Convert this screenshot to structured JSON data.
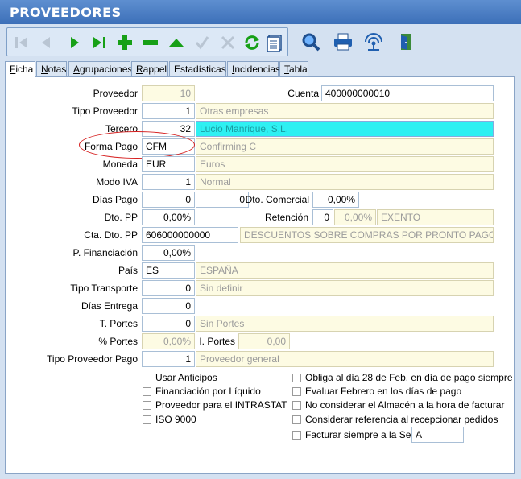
{
  "window": {
    "title": "PROVEEDORES"
  },
  "toolbar": {
    "icons": [
      "first-icon",
      "prev-icon",
      "next-icon",
      "last-icon",
      "add-icon",
      "remove-icon",
      "up-icon",
      "confirm-icon",
      "cancel-icon",
      "refresh-icon",
      "list-icon",
      "search-icon",
      "print-icon",
      "signal-icon",
      "exit-icon"
    ]
  },
  "tabs": [
    {
      "label": "Ficha",
      "accel": "F",
      "rest": "icha"
    },
    {
      "label": "Notas",
      "accel": "N",
      "rest": "otas"
    },
    {
      "label": "Agrupaciones",
      "accel": "A",
      "rest": "grupaciones"
    },
    {
      "label": "Rappel",
      "accel": "R",
      "rest": "appel"
    },
    {
      "label": "Estadísticas",
      "accel": "",
      "rest": "Estadísticas"
    },
    {
      "label": "Incidencias",
      "accel": "I",
      "rest": "ncidencias"
    },
    {
      "label": "Tabla",
      "accel": "T",
      "rest": "abla"
    }
  ],
  "form": {
    "proveedor_label": "Proveedor",
    "proveedor_value": "10",
    "cuenta_label": "Cuenta",
    "cuenta_value": "400000000010",
    "tipo_proveedor_label": "Tipo Proveedor",
    "tipo_proveedor_code": "1",
    "tipo_proveedor_desc": "Otras empresas",
    "tercero_label": "Tercero",
    "tercero_code": "32",
    "tercero_desc": "Lucio Manrique, S.L.",
    "forma_pago_label": "Forma Pago",
    "forma_pago_code": "CFM",
    "forma_pago_desc": "Confirming C",
    "moneda_label": "Moneda",
    "moneda_code": "EUR",
    "moneda_desc": "Euros",
    "modo_iva_label": "Modo IVA",
    "modo_iva_code": "1",
    "modo_iva_desc": "Normal",
    "dias_pago_label": "Días Pago",
    "dias_pago_1": "0",
    "dias_pago_2": "0",
    "dto_comercial_label": "Dto. Comercial",
    "dto_comercial_value": "0,00%",
    "dto_pp_label": "Dto. PP",
    "dto_pp_value": "0,00%",
    "retencion_label": "Retención",
    "retencion_code": "0",
    "retencion_pct": "0,00%",
    "retencion_desc": "EXENTO",
    "cta_dto_pp_label": "Cta. Dto. PP",
    "cta_dto_pp_value": "606000000000",
    "cta_dto_pp_desc": "DESCUENTOS SOBRE COMPRAS POR PRONTO PAGO DE M",
    "p_financiacion_label": "P. Financiación",
    "p_financiacion_value": "0,00%",
    "pais_label": "País",
    "pais_code": "ES",
    "pais_desc": "ESPAÑA",
    "tipo_transporte_label": "Tipo Transporte",
    "tipo_transporte_code": "0",
    "tipo_transporte_desc": "Sin definir",
    "dias_entrega_label": "Días Entrega",
    "dias_entrega_value": "0",
    "t_portes_label": "T. Portes",
    "t_portes_code": "0",
    "t_portes_desc": "Sin Portes",
    "pct_portes_label": "% Portes",
    "pct_portes_value": "0,00%",
    "i_portes_label": "I. Portes",
    "i_portes_value": "0,00",
    "tipo_proveedor_pago_label": "Tipo Proveedor Pago",
    "tipo_proveedor_pago_code": "1",
    "tipo_proveedor_pago_desc": "Proveedor general"
  },
  "checks_left": [
    "Usar Anticipos",
    "Financiación por Líquido",
    "Proveedor para el INTRASTAT",
    "ISO 9000"
  ],
  "checks_right": [
    "Obliga al día 28 de Feb. en día de pago siempre",
    "Evaluar Febrero en los días de pago",
    "No considerar el Almacén a la hora de facturar",
    "Considerar referencia al recepcionar pedidos",
    "Facturar siempre a la Serie"
  ],
  "serie_value": "A",
  "colors": {
    "title_bg": "#3c6fb8",
    "readonly_bg": "#fdfbe3",
    "highlight": "#2ef0f2",
    "annotation": "#d62020"
  }
}
